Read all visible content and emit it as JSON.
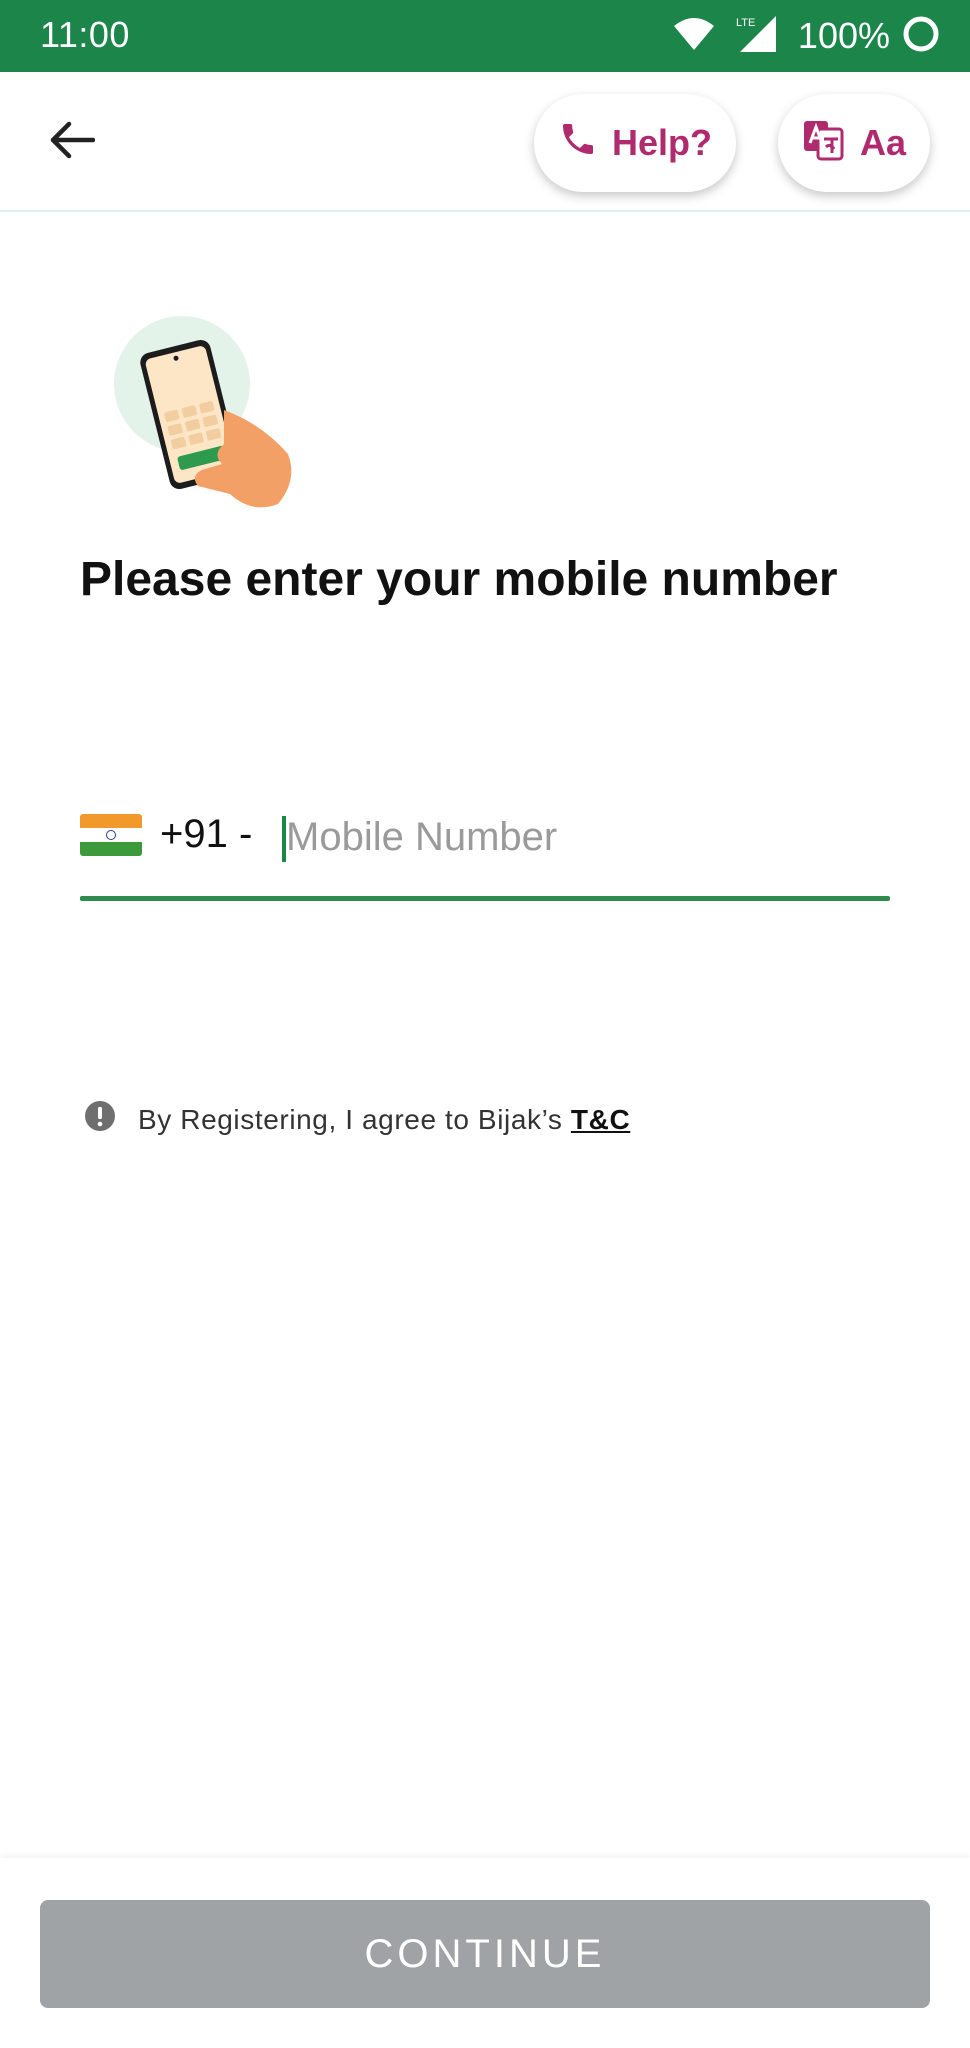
{
  "status_bar": {
    "time": "11:00",
    "network_label": "LTE",
    "battery": "100%",
    "color": "#1c854a"
  },
  "app_bar": {
    "help_label": "Help?",
    "language_label": "Aa",
    "accent_color": "#b02a6e"
  },
  "main": {
    "title": "Please enter your mobile number",
    "country_code": "+91 -",
    "mobile_placeholder": "Mobile Number",
    "mobile_value": "",
    "terms_text": "By Registering, I agree to Bijak’s",
    "terms_link": "T&C"
  },
  "footer": {
    "continue_label": "CONTINUE"
  },
  "icons": [
    "wifi-icon",
    "signal-icon",
    "battery-icon",
    "back-arrow-icon",
    "phone-icon",
    "translate-icon",
    "info-icon",
    "india-flag-icon",
    "phone-illustration"
  ]
}
